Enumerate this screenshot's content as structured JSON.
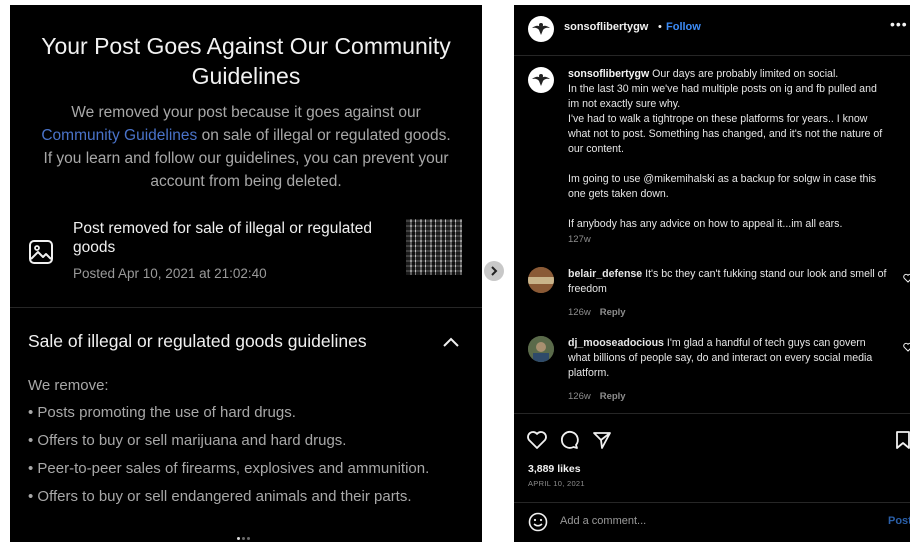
{
  "left_panel": {
    "title": "Your Post Goes Against Our Community Guidelines",
    "body_pre": "We removed your post because it goes against our ",
    "body_link": "Community Guidelines",
    "body_post": " on sale of illegal or regulated goods. If you learn and follow our guidelines, you can prevent your account from being deleted.",
    "notice_title": "Post removed for sale of illegal or regulated goods",
    "notice_date": "Posted Apr 10, 2021 at 21:02:40",
    "section_title": "Sale of illegal or regulated goods guidelines",
    "we_remove": "We remove:",
    "rules": [
      "• Posts promoting the use of hard drugs.",
      "• Offers to buy or sell marijuana and hard drugs.",
      "• Peer-to-peer sales of firearms, explosives and ammunition.",
      "• Offers to buy or sell endangered animals and their parts."
    ]
  },
  "right_panel": {
    "username": "sonsoflibertygw",
    "separator": "•",
    "follow": "Follow",
    "more": "•••",
    "caption_user": "sonsoflibertygw",
    "caption_text": " Our days are probably limited on social.\nIn the last 30 min we've had multiple posts on ig and fb pulled and im not exactly sure why.\nI've had to walk a tightrope on these platforms for years.. I know what not to post. Something has changed, and it's not the nature of our content.\n\nIm going to use @mikemihalski as a backup for solgw in case this one gets taken down.\n\nIf anybody has any advice on how to appeal it...im all ears.",
    "caption_time": "127w",
    "comments": [
      {
        "user": "belair_defense",
        "text": " It's bc they can't fukking stand our look and smell of freedom",
        "time": "126w",
        "reply": "Reply"
      },
      {
        "user": "dj_mooseadocious",
        "text": " I'm glad a handful of tech guys can govern what billions of people say, do and interact on every social media platform.",
        "time": "126w",
        "reply": "Reply"
      }
    ],
    "likes": "3,889 likes",
    "date": "APRIL 10, 2021",
    "add_comment_placeholder": "Add a comment...",
    "post_label": "Post"
  },
  "colors": {
    "background": "#000000",
    "link_blue": "#4a73c9",
    "follow_blue": "#3d8cf7",
    "muted_text": "#a8a8a8"
  },
  "icons": [
    "image-icon",
    "chevron-up-icon",
    "chevron-right-icon",
    "heart-icon",
    "comment-icon",
    "share-icon",
    "bookmark-icon",
    "emoji-icon"
  ]
}
